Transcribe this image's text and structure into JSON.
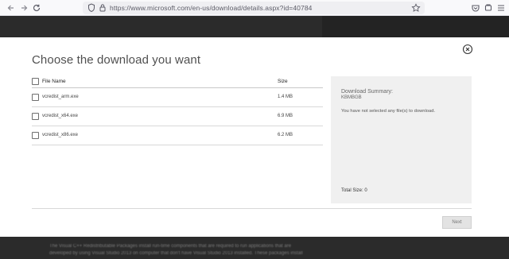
{
  "browser": {
    "url": "https://www.microsoft.com/en-us/download/details.aspx?id=40784",
    "back_icon": "arrow-left-icon",
    "forward_icon": "arrow-right-icon",
    "reload_icon": "reload-icon"
  },
  "modal": {
    "title": "Choose the download you want",
    "table": {
      "col_name": "File Name",
      "col_size": "Size",
      "rows": [
        {
          "name": "vcredist_arm.exe",
          "size": "1.4 MB"
        },
        {
          "name": "vcredist_x64.exe",
          "size": "6.9 MB"
        },
        {
          "name": "vcredist_x86.exe",
          "size": "6.2 MB"
        }
      ]
    },
    "summary": {
      "title": "Download Summary:",
      "size": "KBMBGB",
      "message": "You have not selected any file(s) to download.",
      "total": "Total Size: 0"
    },
    "next_label": "Next"
  },
  "background": {
    "line1": "The Visual C++ Redistributable Packages install run-time components that are required to run applications that are",
    "line2": "developed by using Visual Studio 2013 on computer that don't have Visual Studio 2013 installed. These packages install"
  }
}
